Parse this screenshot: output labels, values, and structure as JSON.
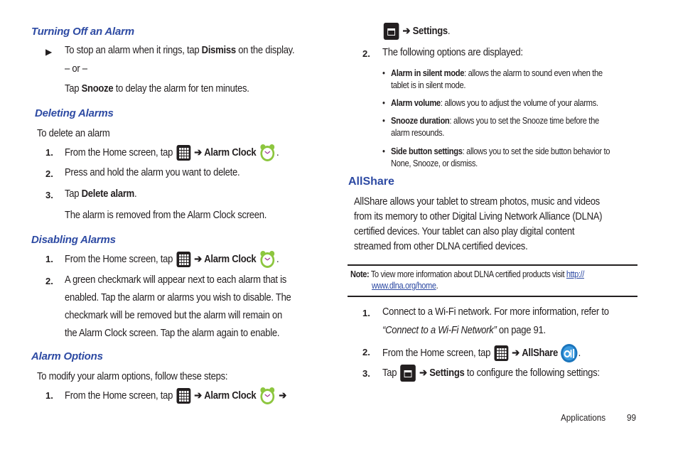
{
  "left": {
    "turning_off": {
      "heading": "Turning Off an Alarm",
      "bullet_pre": "To stop an alarm when it rings, tap ",
      "bullet_bold": "Dismiss",
      "bullet_post": " on the display.",
      "or": "– or –",
      "snooze_pre": "Tap ",
      "snooze_bold": "Snooze",
      "snooze_post": " to delay the alarm for ten minutes."
    },
    "deleting": {
      "heading": "Deleting Alarms",
      "intro": "To delete an alarm",
      "step1_num": "1.",
      "step1_pre": "From the Home screen, tap ",
      "step1_arrow": "➔",
      "step1_bold": "Alarm Clock",
      "step1_post": ".",
      "step2_num": "2.",
      "step2": "Press and hold the alarm you want to delete.",
      "step3_num": "3.",
      "step3_pre": "Tap ",
      "step3_bold": "Delete alarm",
      "step3_post": ".",
      "result": "The alarm is removed from the Alarm Clock screen."
    },
    "disabling": {
      "heading": "Disabling Alarms",
      "step1_num": "1.",
      "step1_pre": "From the Home screen, tap ",
      "step1_arrow": "➔",
      "step1_bold": "Alarm Clock",
      "step1_post": ".",
      "step2_num": "2.",
      "step2_lines": [
        " A green checkmark will appear next to each alarm that is",
        "enabled. Tap the alarm or alarms you wish to disable. The",
        "checkmark will be removed but the alarm will remain on",
        "the Alarm Clock screen. Tap the alarm again to enable."
      ]
    },
    "options": {
      "heading": "Alarm Options",
      "intro": "To modify your alarm options, follow these steps:",
      "step1_num": "1.",
      "step1_pre": "From the Home screen, tap ",
      "step1_arrow": "➔",
      "step1_bold": "Alarm Clock",
      "step1_arrow2": "➔"
    }
  },
  "right": {
    "cont": {
      "arrow": "➔",
      "bold": "Settings",
      "post": "."
    },
    "step2_num": "2.",
    "step2": "The following options are displayed:",
    "options": [
      {
        "bold": "Alarm in silent mode",
        "text": ": allows the alarm to sound even when the",
        "text2": "tablet is in silent mode."
      },
      {
        "bold": "Alarm volume",
        "text": ": allows you to adjust the volume of your alarms.",
        "text2": ""
      },
      {
        "bold": "Snooze duration",
        "text": ": allows you to set the Snooze time before the",
        "text2": "alarm resounds."
      },
      {
        "bold": "Side button settings",
        "text": ": allows you to set the side button behavior to",
        "text2": "None, Snooze, or dismiss."
      }
    ],
    "allshare": {
      "heading": "AllShare",
      "para": [
        "AllShare allows your tablet to stream photos, music and videos",
        "from its memory to other Digital Living Network Alliance (DLNA)",
        "certified devices. Your tablet can also play digital content",
        "streamed from other DLNA certified devices."
      ],
      "note_label": "Note:",
      "note_text": " To view more information about DLNA certified products visit ",
      "note_link1": "http://",
      "note_link2": "www.dlna.org/home",
      "note_post": ".",
      "step1_num": "1.",
      "step1": "Connect to a Wi-Fi network. For more information, refer to",
      "step1_ref": "“Connect to a Wi-Fi Network”",
      "step1_ref_post": "  on page 91.",
      "step2_num": "2.",
      "step2_pre": "From the Home screen, tap ",
      "step2_arrow": "➔",
      "step2_bold": "AllShare",
      "step2_post": ".",
      "step3_num": "3.",
      "step3_pre": "Tap ",
      "step3_arrow": "➔",
      "step3_bold": "Settings",
      "step3_post": " to configure the following settings:"
    }
  },
  "footer": {
    "section": "Applications",
    "page": "99"
  },
  "icons": {
    "apps": "apps-grid-icon",
    "clock": "alarm-clock-icon",
    "menu": "menu-key-icon",
    "allshare": "allshare-icon",
    "bullet": "triangle-bullet-icon"
  },
  "colors": {
    "heading": "#2d4aa3",
    "text": "#231f20",
    "clock_green": "#8dc63f",
    "allshare_blue": "#1b75bc"
  }
}
